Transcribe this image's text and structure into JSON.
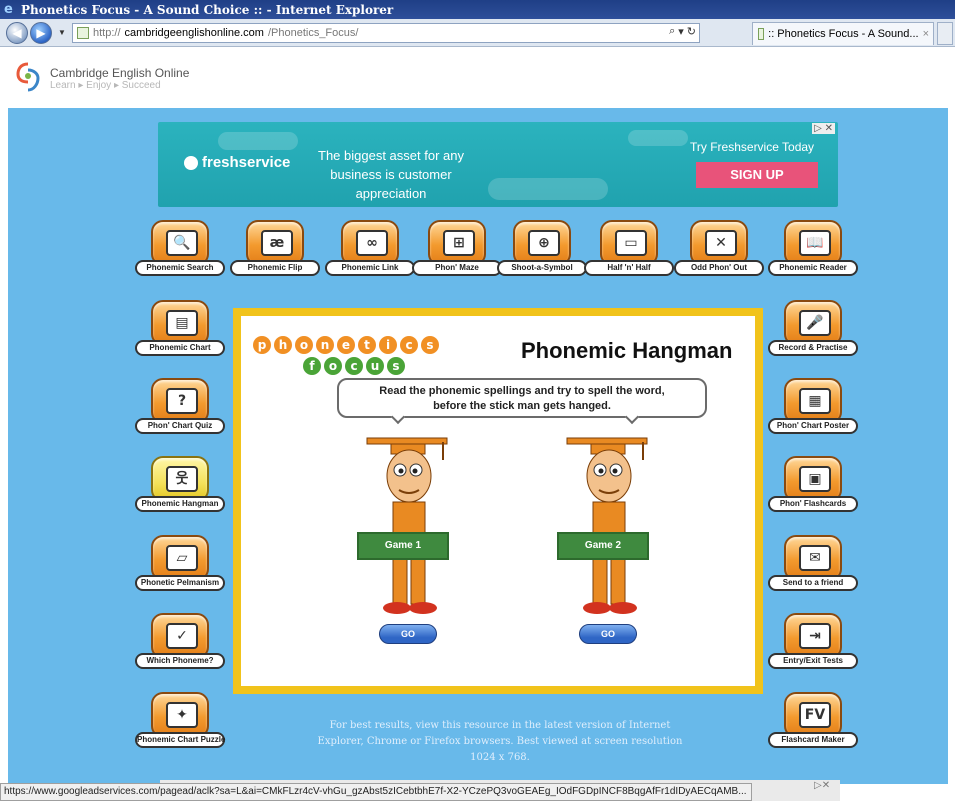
{
  "window": {
    "title": "Phonetics Focus - A Sound Choice :: - Internet Explorer"
  },
  "address_bar": {
    "prefix": "http://",
    "host": "cambridgeenglishonline.com",
    "path": "/Phonetics_Focus/"
  },
  "tab": {
    "label": ":: Phonetics Focus - A Sound...",
    "close": "×"
  },
  "site": {
    "logo_line1": "Cambridge English Online",
    "logo_line2": "Learn ▸ Enjoy ▸ Succeed"
  },
  "ad": {
    "brand": "freshservice",
    "tagline": "The biggest asset for any business is customer appreciation",
    "try_text": "Try Freshservice Today",
    "cta": "SIGN UP",
    "adchoices": "▷ ✕"
  },
  "top_tools": [
    {
      "label": "Phonemic Search",
      "icon": "magnifier-icon",
      "glyph": "🔍"
    },
    {
      "label": "Phonemic Flip",
      "icon": "flip-card-icon",
      "glyph": "æ"
    },
    {
      "label": "Phonemic Link",
      "icon": "chain-link-icon",
      "glyph": "∞"
    },
    {
      "label": "Phon' Maze",
      "icon": "maze-icon",
      "glyph": "⊞"
    },
    {
      "label": "Shoot-a-Symbol",
      "icon": "crosshair-icon",
      "glyph": "⊕"
    },
    {
      "label": "Half 'n' Half",
      "icon": "half-card-icon",
      "glyph": "▭"
    },
    {
      "label": "Odd Phon' Out",
      "icon": "odd-grid-icon",
      "glyph": "✕"
    },
    {
      "label": "Phonemic Reader",
      "icon": "book-icon",
      "glyph": "📖"
    }
  ],
  "left_tools": [
    {
      "label": "Phonemic Chart",
      "icon": "chart-sheet-icon",
      "glyph": "▤"
    },
    {
      "label": "Phon' Chart Quiz",
      "icon": "quiz-icon",
      "glyph": "?"
    },
    {
      "label": "Phonemic Hangman",
      "icon": "hangman-icon",
      "glyph": "웃"
    },
    {
      "label": "Phonetic Pelmanism",
      "icon": "cards-icon",
      "glyph": "▱"
    },
    {
      "label": "Which Phoneme?",
      "icon": "tick-cross-icon",
      "glyph": "✓"
    },
    {
      "label": "Phonemic Chart Puzzle",
      "icon": "puzzle-icon",
      "glyph": "✦"
    }
  ],
  "right_tools": [
    {
      "label": "Record & Practise",
      "icon": "microphone-icon",
      "glyph": "🎤"
    },
    {
      "label": "Phon' Chart Poster",
      "icon": "poster-icon",
      "glyph": "▦"
    },
    {
      "label": "Phon' Flashcards",
      "icon": "flashcard-icon",
      "glyph": "▣"
    },
    {
      "label": "Send to a friend",
      "icon": "mailbox-icon",
      "glyph": "✉"
    },
    {
      "label": "Entry/Exit Tests",
      "icon": "arrows-icon",
      "glyph": "⇥"
    },
    {
      "label": "Flashcard Maker",
      "icon": "fv-card-icon",
      "glyph": "FV"
    }
  ],
  "game": {
    "logo_top": [
      "p",
      "h",
      "o",
      "n",
      "e",
      "t",
      "i",
      "c",
      "s"
    ],
    "logo_bottom": [
      "f",
      "o",
      "c",
      "u",
      "s"
    ],
    "title": "Phonemic Hangman",
    "instruction_line1": "Read the phonemic spellings and try to spell the word,",
    "instruction_line2": "before the stick man gets hanged.",
    "game1_label": "Game 1",
    "game2_label": "Game 2",
    "go_label": "GO"
  },
  "footer_note": "For best results, view this resource in the latest version of Internet Explorer, Chrome or Firefox browsers. Best viewed at screen resolution 1024 x 768.",
  "status_url": "https://www.googleadservices.com/pagead/aclk?sa=L&ai=CMkFLzr4cV-vhGu_gzAbst5zICebtbhE7f-X2-YCzePQ3voGEAEg_IOdFGDpINCF8BqgAfFr1dIDyAECqAMB...",
  "colors": {
    "page_bg": "#68b9ea",
    "panel_border": "#f1c31b",
    "tool_orange": "#f39a2e",
    "ad_teal": "#2bb3be",
    "signup_pink": "#e8537a"
  }
}
